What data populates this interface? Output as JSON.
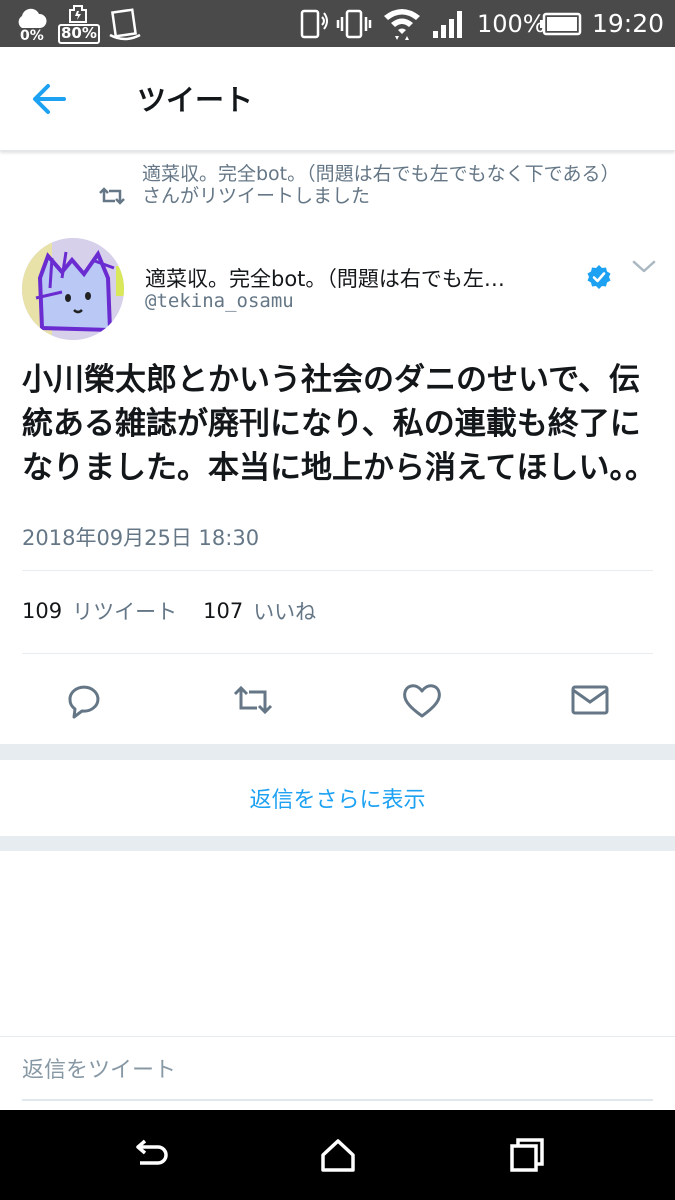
{
  "status_bar": {
    "data_saver_pct": "0%",
    "battery_saver_pct": "80%",
    "battery_pct": "100%",
    "time": "19:20"
  },
  "header": {
    "title": "ツイート",
    "back_icon": "arrow-left-icon"
  },
  "retweet_context": {
    "text": "適菜収。完全bot。（問題は右でも左でもなく下である）さんがリツイートしました",
    "icon": "retweet-icon"
  },
  "tweet": {
    "author_name": "適菜収。完全bot。（問題は右でも左…",
    "author_handle": "@tekina_osamu",
    "verified_icon": "verified-badge-icon",
    "text": "小川榮太郎とかいう社会のダニのせいで、伝統ある雑誌が廃刊になり、私の連載も終了になりました。本当に地上から消えてほしい。。",
    "timestamp": "2018年09月25日 18:30",
    "retweet_count": "109",
    "retweet_label": "リツイート",
    "like_count": "107",
    "like_label": "いいね"
  },
  "actions": {
    "reply_icon": "reply-icon",
    "retweet_icon": "retweet-icon",
    "like_icon": "heart-icon",
    "dm_icon": "envelope-icon"
  },
  "more_replies_label": "返信をさらに表示",
  "reply_box": {
    "placeholder": "返信をツイート"
  },
  "colors": {
    "accent": "#1da1f2",
    "muted": "#657786",
    "status_bar": "#4a4a4a",
    "nav_bar": "#000000"
  }
}
